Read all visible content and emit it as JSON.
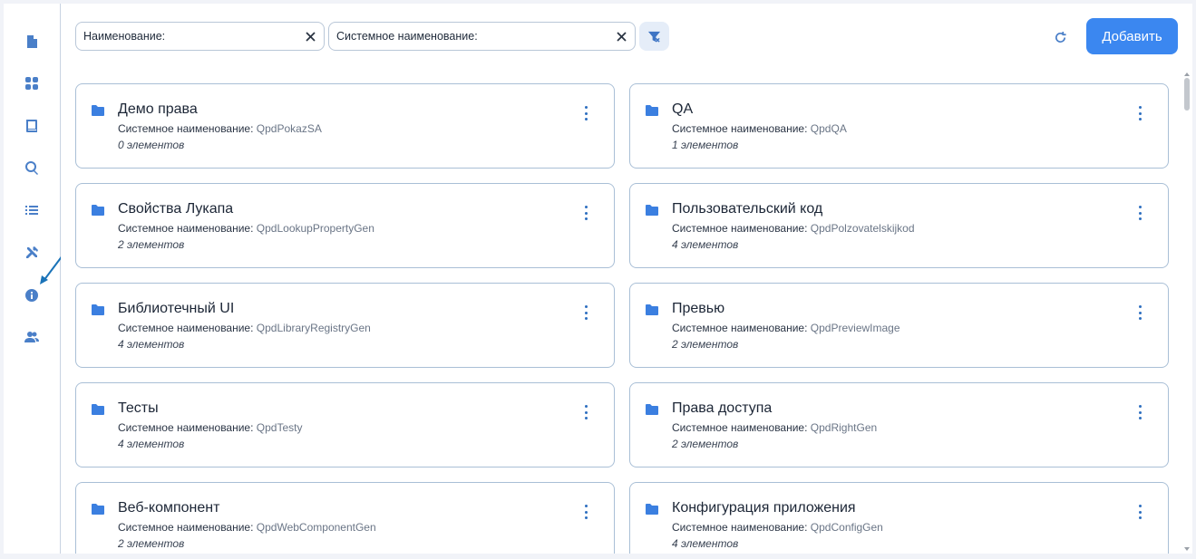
{
  "filters": {
    "name_label": "Наименование:",
    "name_value": "",
    "sysname_label": "Системное наименование:",
    "sysname_value": ""
  },
  "toolbar": {
    "add_label": "Добавить"
  },
  "sidebar": {
    "icons": [
      "document-icon",
      "dashboard-icon",
      "book-icon",
      "search-icon",
      "list-icon",
      "tools-icon",
      "info-icon",
      "users-icon"
    ]
  },
  "cards": [
    {
      "title": "Демо права",
      "sys_label": "Системное наименование:",
      "sys_value": "QpdPokazSA",
      "count": "0 элементов"
    },
    {
      "title": "QA",
      "sys_label": "Системное наименование:",
      "sys_value": "QpdQA",
      "count": "1 элементов"
    },
    {
      "title": "Свойства Лукапа",
      "sys_label": "Системное наименование:",
      "sys_value": "QpdLookupPropertyGen",
      "count": "2 элементов"
    },
    {
      "title": "Пользовательский код",
      "sys_label": "Системное наименование:",
      "sys_value": "QpdPolzovatelskijkod",
      "count": "4 элементов"
    },
    {
      "title": "Библиотечный UI",
      "sys_label": "Системное наименование:",
      "sys_value": "QpdLibraryRegistryGen",
      "count": "4 элементов"
    },
    {
      "title": "Превью",
      "sys_label": "Системное наименование:",
      "sys_value": "QpdPreviewImage",
      "count": "2 элементов"
    },
    {
      "title": "Тесты",
      "sys_label": "Системное наименование:",
      "sys_value": "QpdTesty",
      "count": "4 элементов"
    },
    {
      "title": "Права доступа",
      "sys_label": "Системное наименование:",
      "sys_value": "QpdRightGen",
      "count": "2 элементов"
    },
    {
      "title": "Веб-компонент",
      "sys_label": "Системное наименование:",
      "sys_value": "QpdWebComponentGen",
      "count": "2 элементов"
    },
    {
      "title": "Конфигурация приложения",
      "sys_label": "Системное наименование:",
      "sys_value": "QpdConfigGen",
      "count": "4 элементов"
    }
  ],
  "colors": {
    "accent": "#3b87f0",
    "icon": "#4a7fc8",
    "folder": "#3b7fe0",
    "annotation": "#1a73b8"
  }
}
